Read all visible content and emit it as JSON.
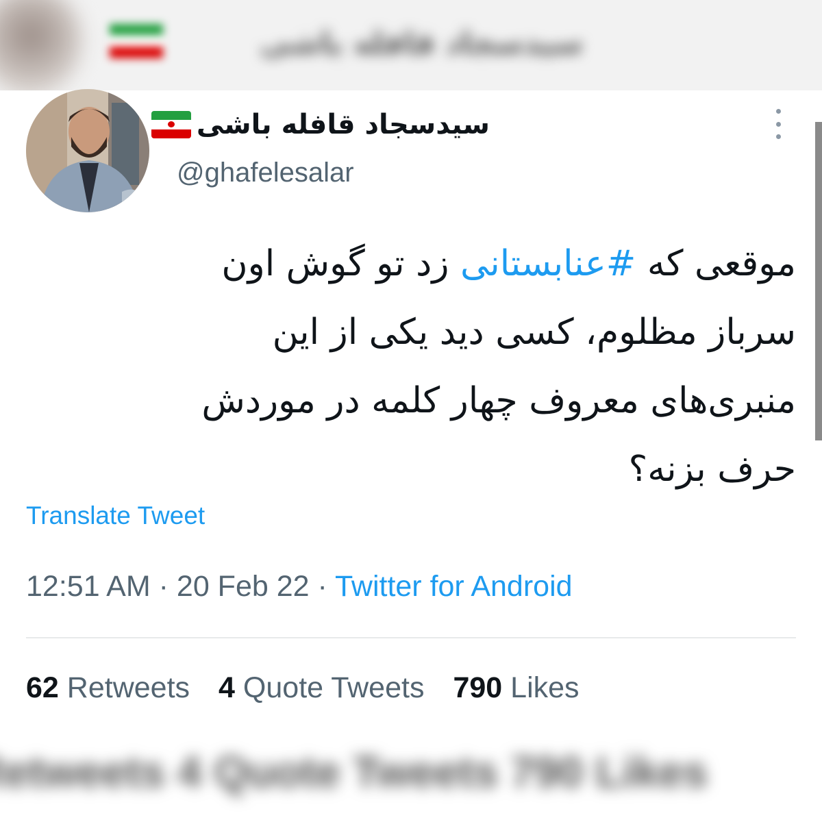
{
  "tweet": {
    "display_name": "سیدسجاد قافله باشی",
    "handle": "@ghafelesalar",
    "flag_icon": "iran-flag-icon",
    "body_lines": [
      {
        "before": "موقعی که ",
        "hashtag": "#عنابستانی",
        "after": " زد تو گوش اون"
      },
      {
        "text": "سرباز مظلوم، کسی دید یکی از این"
      },
      {
        "text": "منبری‌های معروف چهار کلمه در موردش"
      },
      {
        "text": "حرف بزنه؟"
      }
    ],
    "translate_label": "Translate Tweet",
    "time": "12:51 AM",
    "separator": " · ",
    "date": "20 Feb 22",
    "source": "Twitter for Android",
    "stats": {
      "retweets_count": "62",
      "retweets_label": "Retweets",
      "quotes_count": "4",
      "quotes_label": "Quote Tweets",
      "likes_count": "790",
      "likes_label": "Likes"
    }
  },
  "blurred_top": {
    "name": "سیدسجاد قافله باشی"
  },
  "blurred_bottom": {
    "stats": "Retweets   4 Quote Tweets   790 Likes"
  },
  "colors": {
    "link": "#1d9bf0",
    "text": "#0f1419",
    "secondary": "#536471",
    "divider": "#e7e9ea"
  }
}
